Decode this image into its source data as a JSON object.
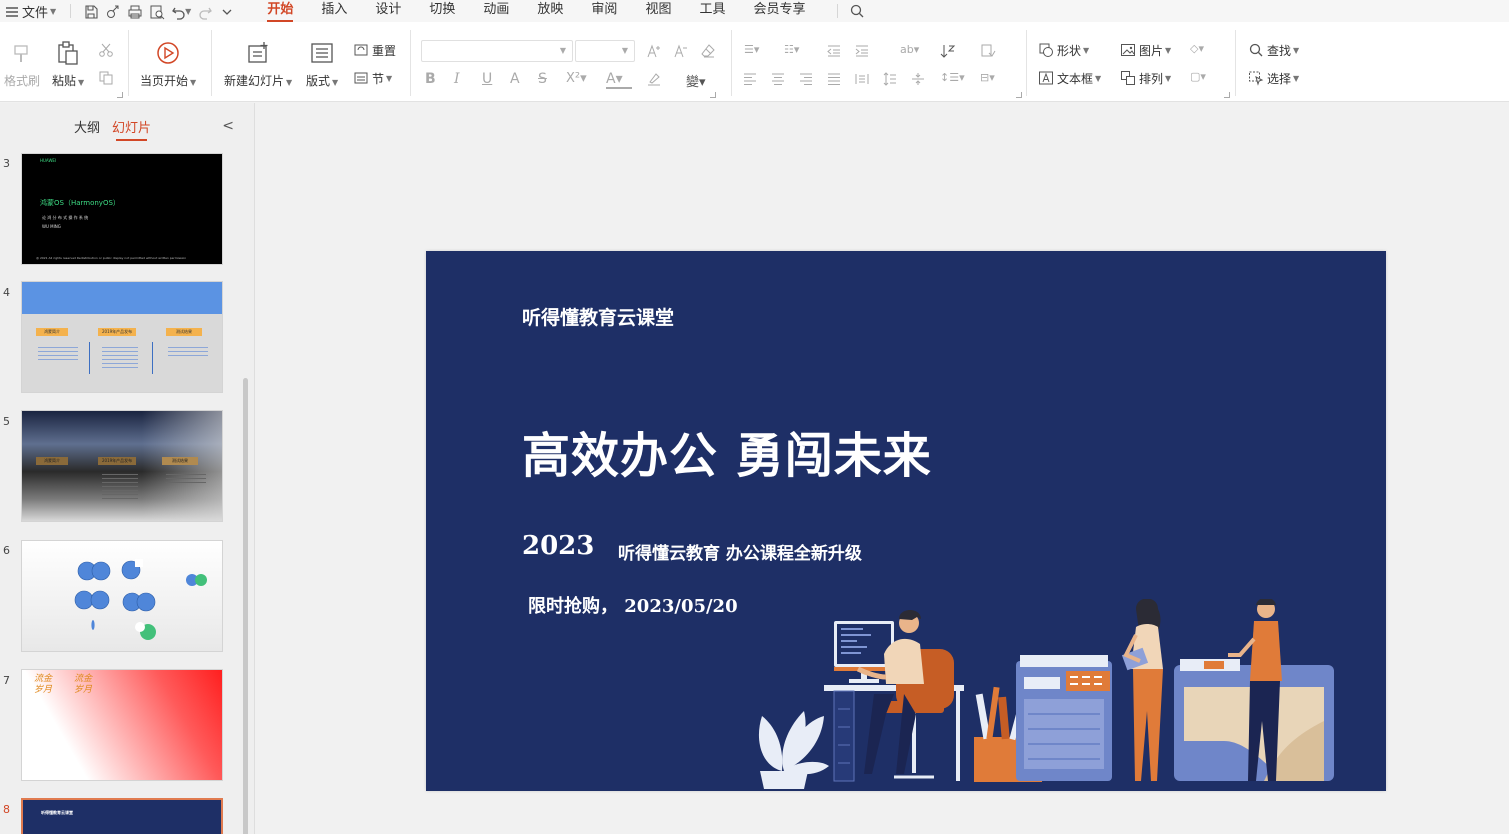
{
  "quick_access": {
    "file_label": "文件"
  },
  "tabs": [
    {
      "label": "开始",
      "active": true
    },
    {
      "label": "插入"
    },
    {
      "label": "设计"
    },
    {
      "label": "切换"
    },
    {
      "label": "动画"
    },
    {
      "label": "放映"
    },
    {
      "label": "审阅"
    },
    {
      "label": "视图"
    },
    {
      "label": "工具"
    },
    {
      "label": "会员专享"
    }
  ],
  "ribbon": {
    "format_painter": "格式刷",
    "paste": "粘贴",
    "start_from_current": "当页开始",
    "new_slide": "新建幻灯片",
    "layout": "版式",
    "reset": "重置",
    "section": "节",
    "shape": "形状",
    "picture": "图片",
    "textbox": "文本框",
    "arrange": "排列",
    "find": "查找",
    "select": "选择"
  },
  "panel": {
    "tabs": [
      {
        "label": "大纲"
      },
      {
        "label": "幻灯片",
        "active": true
      }
    ],
    "slide_numbers": [
      "3",
      "4",
      "5",
      "6",
      "7",
      "8"
    ],
    "thumb3": {
      "brand": "HUAWEI",
      "title": "鸿蒙OS（HarmonyOS）",
      "subtitle": "论 鸿 分 布 式 操 作 系 统",
      "author": "WU MING",
      "footer": "@ 2021 All rights reserved Redistribution or public display not permitted without written permission"
    },
    "thumb4": {
      "headers": [
        "鸿蒙简介",
        "2019年产品发布",
        "测试结果"
      ]
    },
    "thumb5": {
      "headers": [
        "鸿蒙简介",
        "2019年产品发布",
        "测试结果"
      ]
    },
    "thumb7": {
      "chars": "流金岁月"
    },
    "thumb8": {
      "title": "听得懂教育云课堂"
    }
  },
  "slide": {
    "brand": "听得懂教育云课堂",
    "title": "高效办公 勇闯未来",
    "year": "2023",
    "subtitle": "听得懂云教育 办公课程全新升级",
    "promo": "限时抢购， 2023/05/20",
    "colors": {
      "background": "#1e2f66",
      "accent_orange": "#e07b39",
      "machine_blue": "#6f86c9"
    }
  },
  "colors": {
    "accent": "#d24726",
    "selected_thumb_border": "#e07b50"
  }
}
